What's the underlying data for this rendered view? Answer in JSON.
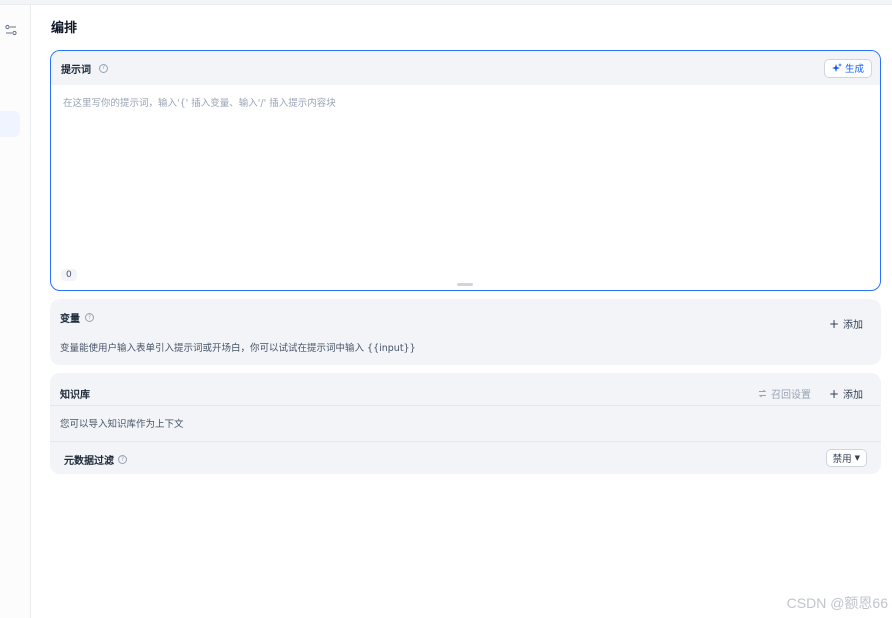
{
  "page": {
    "title": "编排"
  },
  "prompt": {
    "label": "提示词",
    "generate_label": "生成",
    "placeholder": "在这里写你的提示词，输入'{' 插入变量、输入'/' 插入提示内容块",
    "char_count": "0"
  },
  "variables": {
    "label": "变量",
    "add_label": "添加",
    "description": "变量能使用户输入表单引入提示词或开场白，你可以试试在提示词中输入 {{input}}"
  },
  "knowledge": {
    "label": "知识库",
    "recall_label": "召回设置",
    "add_label": "添加",
    "description": "您可以导入知识库作为上下文",
    "metadata_label": "元数据过滤",
    "metadata_value": "禁用"
  },
  "watermark": "CSDN @额恩66",
  "colors": {
    "accent": "#2970ff",
    "card_bg": "#f2f4f7"
  },
  "icons": [
    "config-icon",
    "help-icon",
    "sparkle-icon",
    "plus-icon",
    "recall-settings-icon",
    "chevron-down-icon"
  ]
}
